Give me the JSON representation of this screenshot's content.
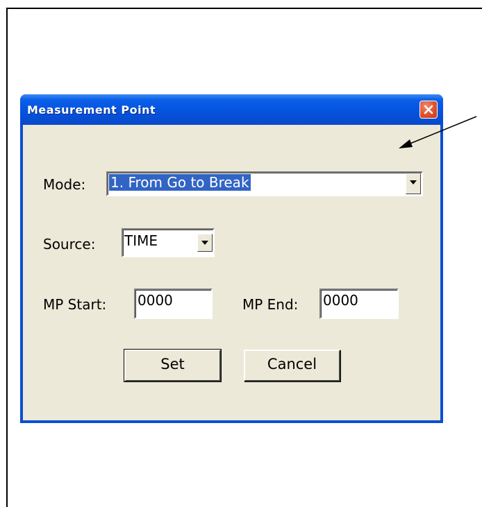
{
  "dialog": {
    "title": "Measurement Point",
    "close_icon": "close-icon"
  },
  "mode": {
    "label": "Mode:",
    "selected": "1. From Go to Break"
  },
  "source": {
    "label": "Source:",
    "selected": "TIME"
  },
  "mp_start": {
    "label": "MP Start:",
    "value": "0000"
  },
  "mp_end": {
    "label": "MP End:",
    "value": "0000"
  },
  "buttons": {
    "set_label": "Set",
    "cancel_label": "Cancel"
  },
  "colors": {
    "titlebar": "#0553df",
    "client_bg": "#ece9d8",
    "selection": "#3164c4",
    "close": "#e0502d"
  }
}
